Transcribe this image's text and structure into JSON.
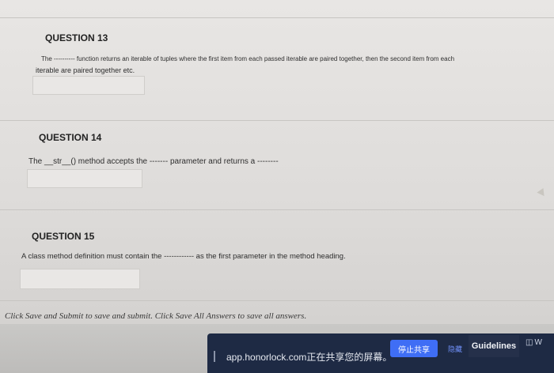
{
  "questions": [
    {
      "title": "QUESTION 13",
      "text_line1": "The ---------- function returns an iterable of tuples where the first item from each passed iterable are paired together, then the second item from each",
      "text_line2": "iterable are paired together etc.",
      "answer": ""
    },
    {
      "title": "QUESTION 14",
      "text_line1": "The __str__() method accepts the ------- parameter and returns a --------",
      "answer": ""
    },
    {
      "title": "QUESTION 15",
      "text_line1": "A class method definition must contain the ------------ as the first parameter in the method heading.",
      "answer": ""
    }
  ],
  "footer": {
    "instructions": "Click Save and Submit to save and submit. Click Save All Answers to save all answers."
  },
  "share_bar": {
    "url_text": "app.honorlock.com正在共享您的屏幕。",
    "stop_label": "停止共享",
    "hide_label": "隐藏",
    "guidelines_label": "Guidelines",
    "right_icon_text": "W"
  }
}
